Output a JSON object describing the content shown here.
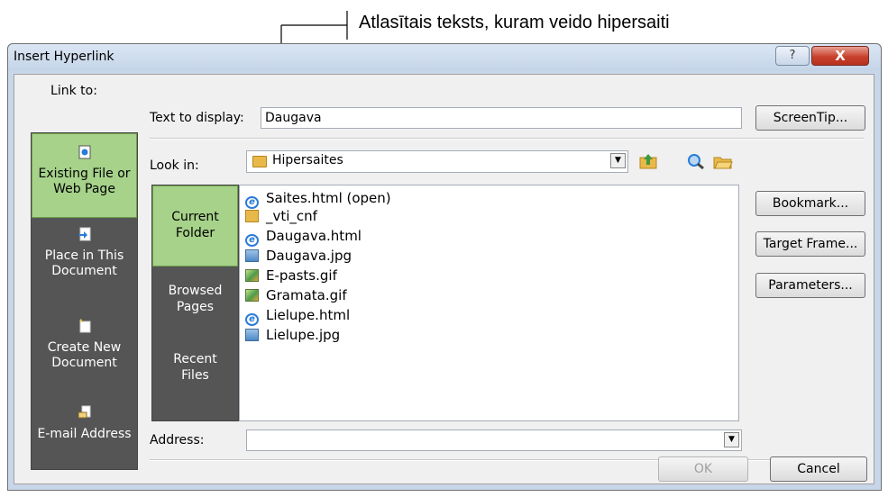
{
  "annotation": {
    "text": "Atlasītais teksts, kuram veido hipersaiti"
  },
  "dialog": {
    "title": "Insert Hyperlink",
    "help_button": "?",
    "close_button": "X"
  },
  "link_to": {
    "label": "Link to:",
    "items": [
      {
        "line1": "Existing File or",
        "line2": "Web Page",
        "selected": true,
        "icon": "web-page-icon"
      },
      {
        "line1": "Place in This",
        "line2": "Document",
        "selected": false,
        "icon": "place-in-document-icon"
      },
      {
        "line1": "Create New",
        "line2": "Document",
        "selected": false,
        "icon": "new-document-icon"
      },
      {
        "line1": "E-mail Address",
        "line2": "",
        "selected": false,
        "icon": "email-icon"
      }
    ]
  },
  "text_to_display": {
    "label": "Text to display:",
    "value": "Daugava"
  },
  "look_in": {
    "label": "Look in:",
    "value": "Hipersaites"
  },
  "browse": {
    "items": [
      {
        "line1": "Current",
        "line2": "Folder",
        "selected": true
      },
      {
        "line1": "Browsed",
        "line2": "Pages",
        "selected": false
      },
      {
        "line1": "Recent",
        "line2": "Files",
        "selected": false
      }
    ]
  },
  "files": [
    {
      "name": "Saites.html (open)",
      "type": "html"
    },
    {
      "name": "_vti_cnf",
      "type": "folder"
    },
    {
      "name": "Daugava.html",
      "type": "html"
    },
    {
      "name": "Daugava.jpg",
      "type": "jpg"
    },
    {
      "name": "E-pasts.gif",
      "type": "gif"
    },
    {
      "name": "Gramata.gif",
      "type": "gif"
    },
    {
      "name": "Lielupe.html",
      "type": "html"
    },
    {
      "name": "Lielupe.jpg",
      "type": "jpg"
    }
  ],
  "address": {
    "label": "Address:",
    "value": ""
  },
  "buttons": {
    "screentip": "ScreenTip...",
    "bookmark": "Bookmark...",
    "target_frame": "Target Frame...",
    "parameters": "Parameters...",
    "ok": "OK",
    "cancel": "Cancel"
  },
  "colors": {
    "selected_green": "#a6d28a",
    "pane_dark": "#555555",
    "close_red": "#c7422d"
  }
}
